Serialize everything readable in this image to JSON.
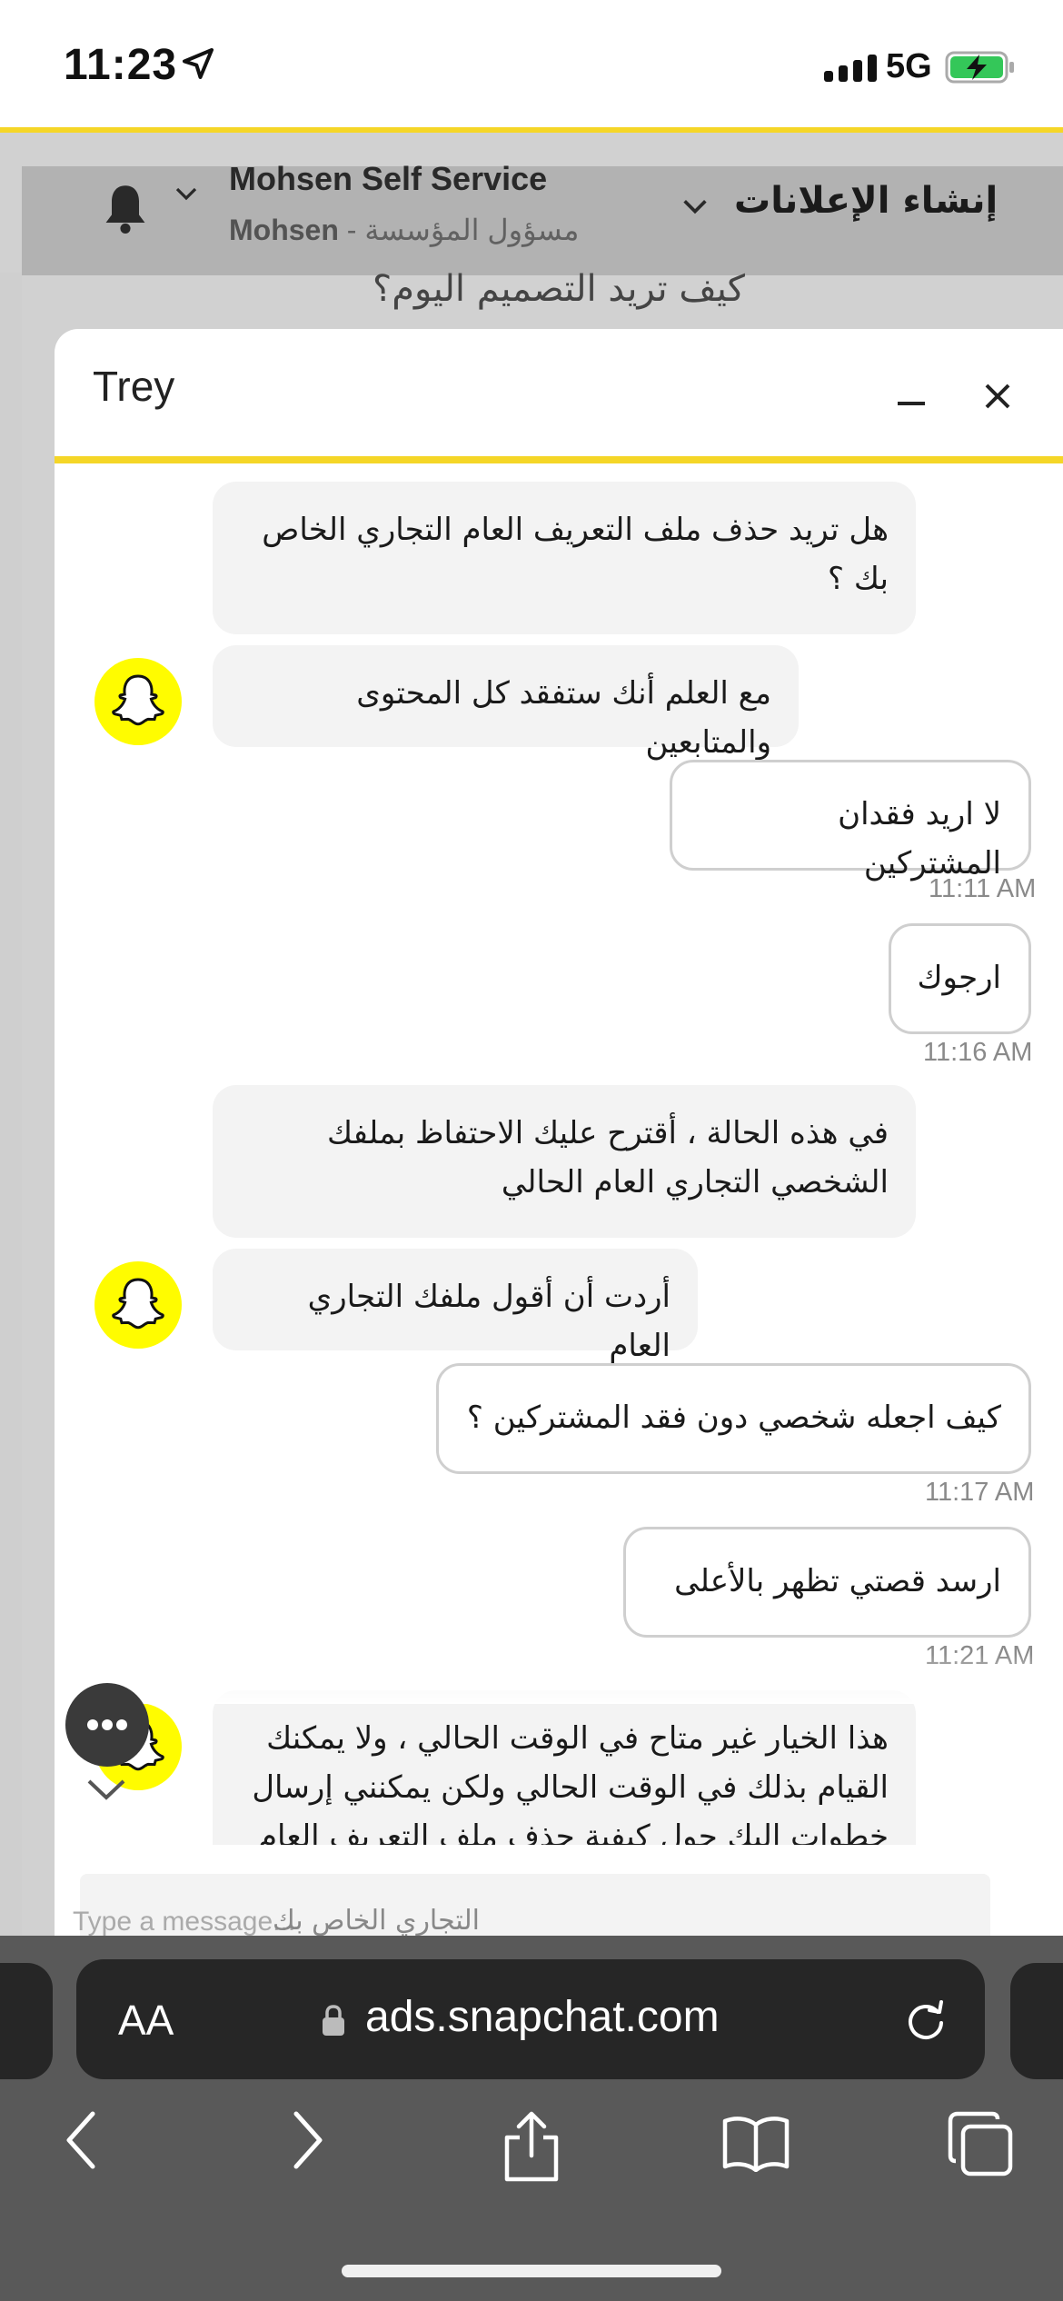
{
  "status_bar": {
    "time": "11:23",
    "network": "5G",
    "icons": [
      "location-arrow-icon",
      "signal-icon",
      "battery-charging-icon"
    ]
  },
  "header": {
    "account_name": "Mohsen Self Service",
    "account_user": "Mohsen",
    "account_role": " - مسؤول المؤسسة",
    "create_ads_label": "إنشاء الإعلانات",
    "background_question": "كيف تريد التصميم اليوم؟"
  },
  "chat": {
    "title": "Trey",
    "messages": [
      {
        "sender": "agent",
        "text": "هل تريد حذف ملف التعريف العام التجاري الخاص بك ؟"
      },
      {
        "sender": "agent",
        "text": "مع العلم أنك ستفقد كل المحتوى والمتابعين"
      },
      {
        "sender": "user",
        "text": "لا اريد فقدان المشتركين",
        "time": "11:11 AM"
      },
      {
        "sender": "user",
        "text": "ارجوك",
        "time": "11:16 AM"
      },
      {
        "sender": "agent",
        "text": "في هذه الحالة ، أقترح عليك الاحتفاظ بملفك الشخصي التجاري العام الحالي"
      },
      {
        "sender": "agent",
        "text": "أردت أن أقول ملفك التجاري العام"
      },
      {
        "sender": "user",
        "text": "كيف اجعله شخصي دون فقد المشتركين ؟",
        "time": "11:17 AM"
      },
      {
        "sender": "user",
        "text": "ارسد قصتي تظهر بالأعلى",
        "time": "11:21 AM"
      },
      {
        "sender": "agent",
        "text": "هذا الخيار غير متاح في الوقت الحالي ، ولا يمكنك القيام بذلك في الوقت الحالي ولكن يمكنني إرسال خطوات إليك حول كيفية حذف ملف التعريف العام"
      }
    ],
    "input_placeholder": "Type a message...",
    "input_overlay_text": "التجاري الخاص بك"
  },
  "browser": {
    "text_size_label": "AA",
    "url": "ads.snapchat.com",
    "toolbar": [
      "back-icon",
      "forward-icon",
      "share-icon",
      "bookmarks-icon",
      "tabs-icon"
    ]
  },
  "colors": {
    "snap_yellow": "#fffc00",
    "accent_yellow": "#f5d627",
    "safari_gray": "#595959"
  }
}
